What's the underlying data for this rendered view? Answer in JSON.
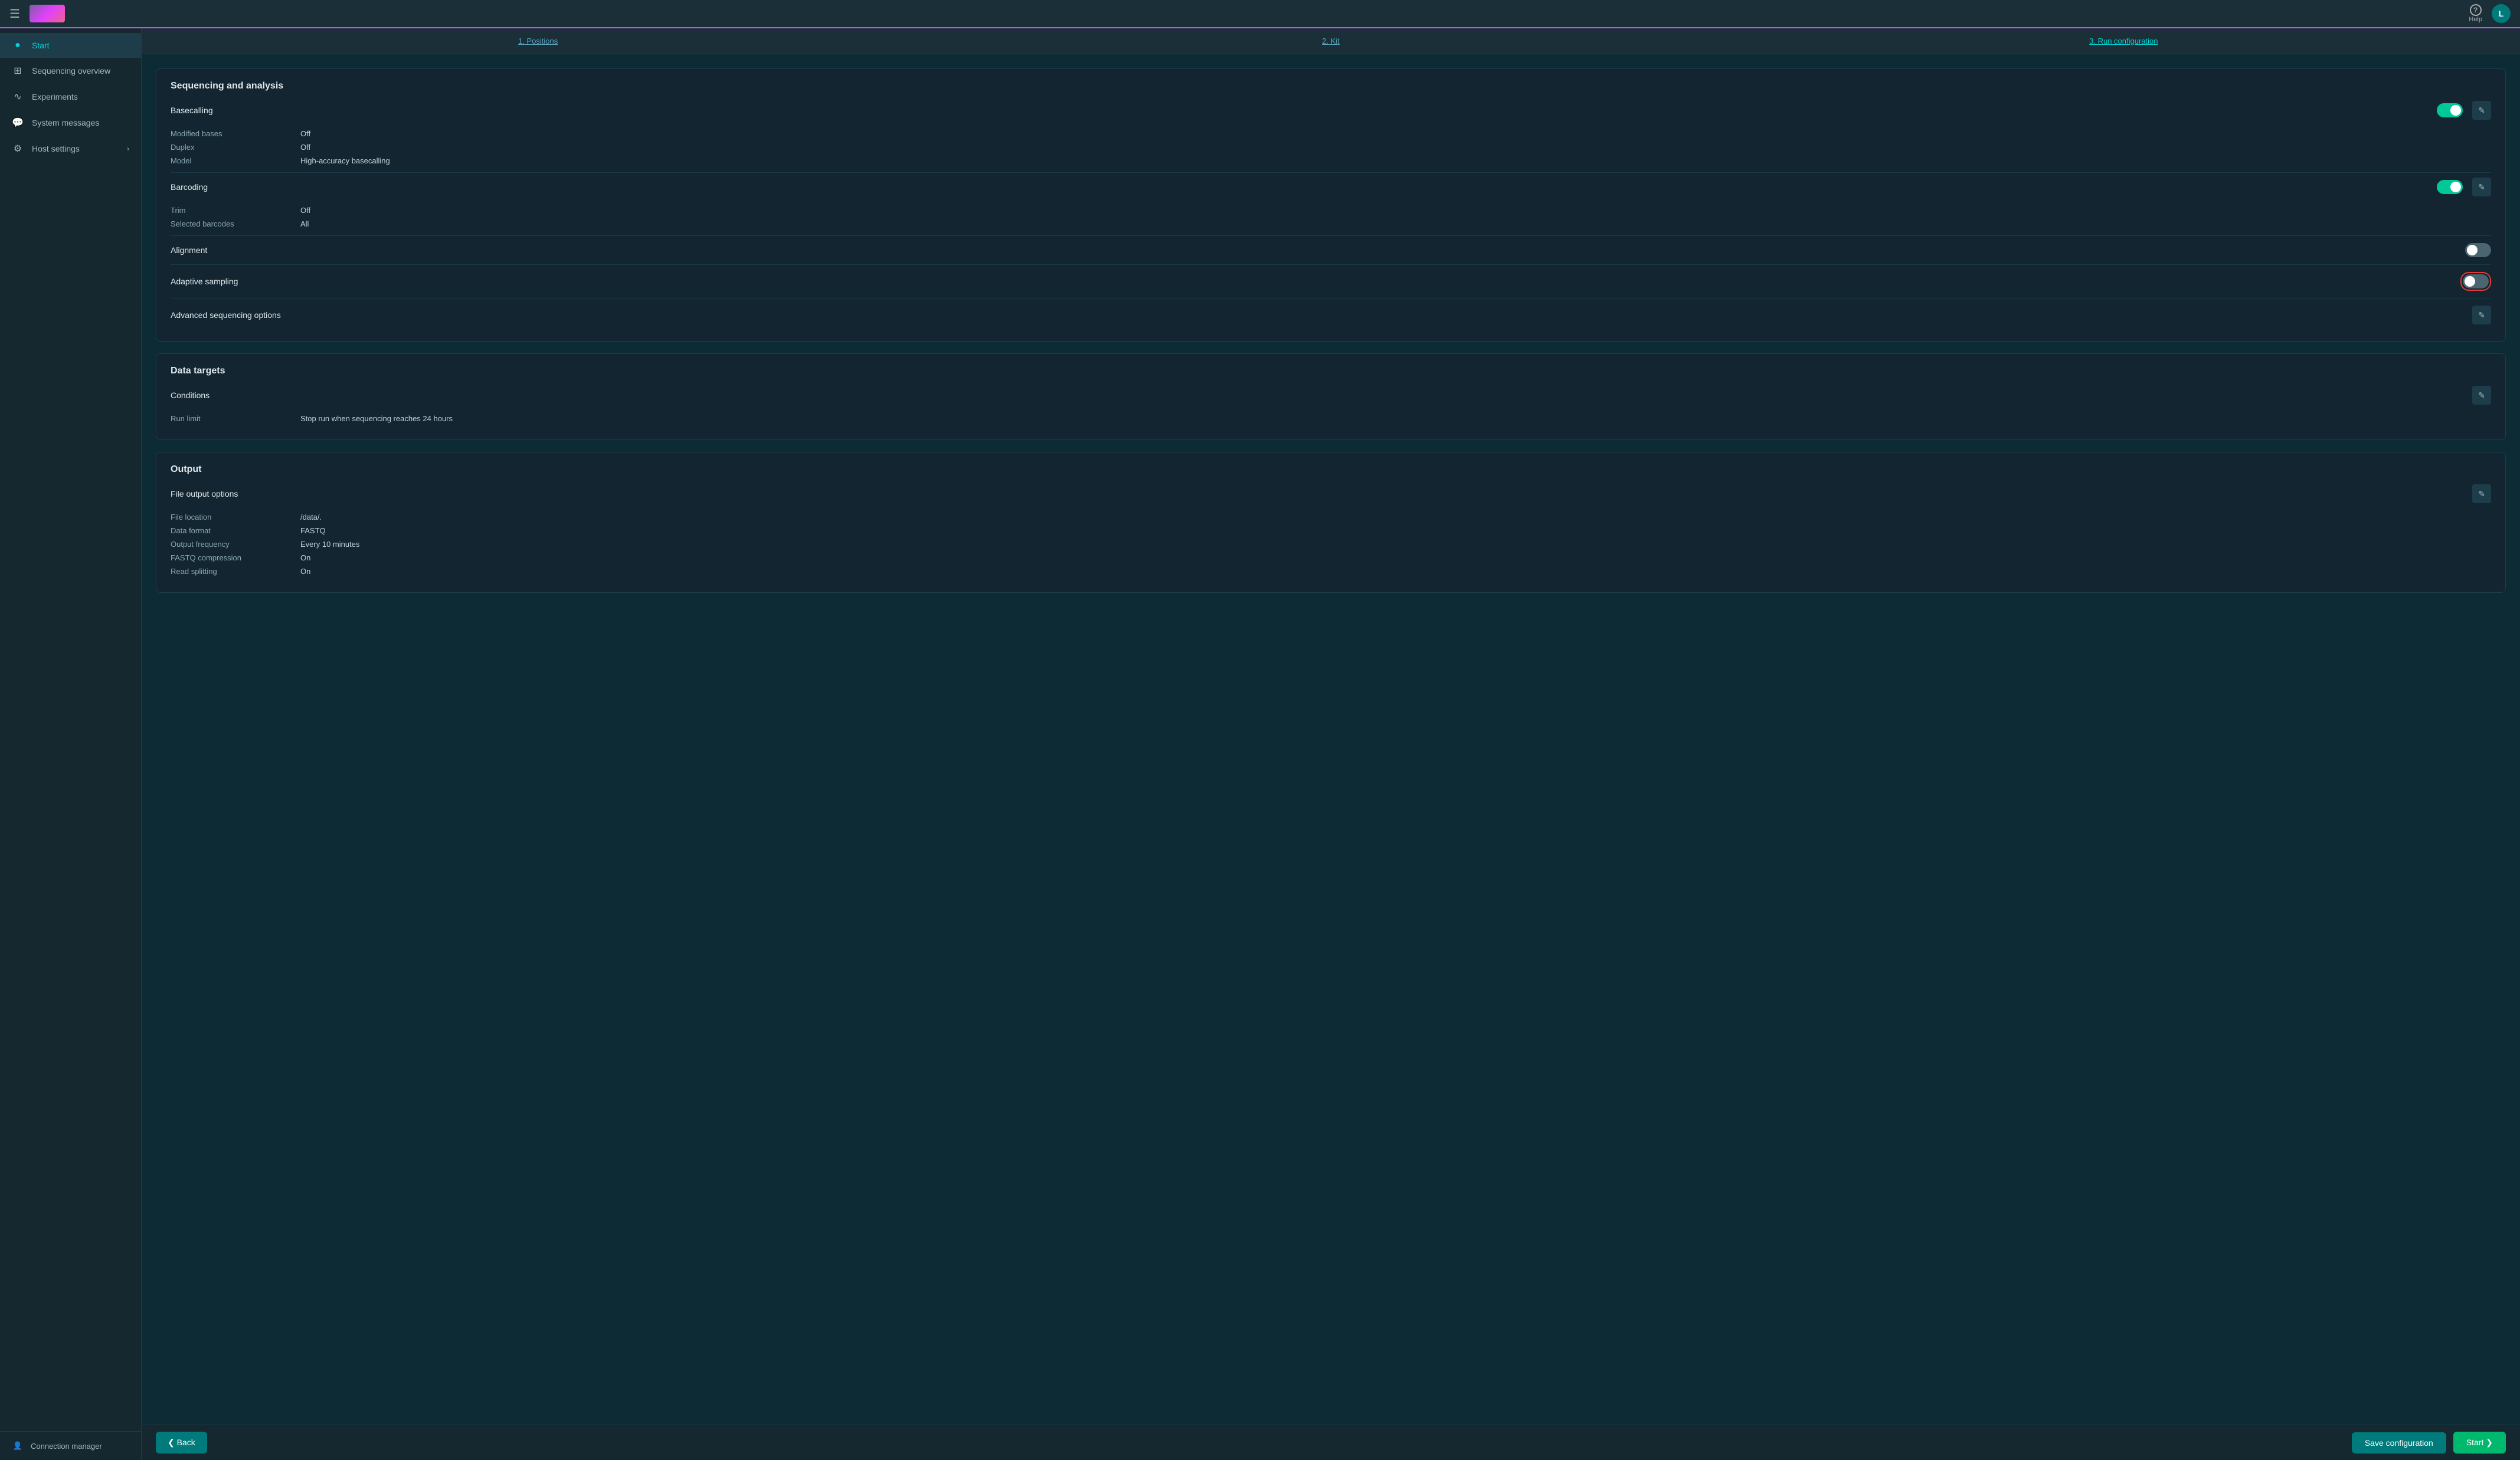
{
  "topbar": {
    "menu_label": "☰",
    "help_label": "Help",
    "avatar_label": "L"
  },
  "sidebar": {
    "items": [
      {
        "id": "start",
        "label": "Start",
        "icon": "●",
        "active": true
      },
      {
        "id": "sequencing-overview",
        "label": "Sequencing overview",
        "icon": "⊞"
      },
      {
        "id": "experiments",
        "label": "Experiments",
        "icon": "∿"
      },
      {
        "id": "system-messages",
        "label": "System messages",
        "icon": "💬"
      },
      {
        "id": "host-settings",
        "label": "Host settings",
        "icon": "⚙",
        "has_chevron": true
      }
    ],
    "bottom": {
      "icon": "👤",
      "label": "Connection manager"
    }
  },
  "step_nav": {
    "steps": [
      {
        "id": "positions",
        "label": "1. Positions"
      },
      {
        "id": "kit",
        "label": "2. Kit"
      },
      {
        "id": "run-configuration",
        "label": "3. Run configuration",
        "active": true
      }
    ]
  },
  "sequencing_analysis": {
    "section_title": "Sequencing and analysis",
    "basecalling": {
      "label": "Basecalling",
      "toggle_state": "on",
      "fields": [
        {
          "label": "Modified bases",
          "value": "Off"
        },
        {
          "label": "Duplex",
          "value": "Off"
        },
        {
          "label": "Model",
          "value": "High-accuracy basecalling"
        }
      ]
    },
    "barcoding": {
      "label": "Barcoding",
      "toggle_state": "on",
      "fields": [
        {
          "label": "Trim",
          "value": "Off"
        },
        {
          "label": "Selected barcodes",
          "value": "All"
        }
      ]
    },
    "alignment": {
      "label": "Alignment",
      "toggle_state": "off"
    },
    "adaptive_sampling": {
      "label": "Adaptive sampling",
      "toggle_state": "off",
      "highlighted": true
    },
    "advanced": {
      "label": "Advanced sequencing options"
    }
  },
  "data_targets": {
    "section_title": "Data targets",
    "conditions": {
      "label": "Conditions",
      "fields": [
        {
          "label": "Run limit",
          "value": "Stop run when sequencing reaches 24 hours"
        }
      ]
    }
  },
  "output": {
    "section_title": "Output",
    "file_output": {
      "label": "File output options",
      "fields": [
        {
          "label": "File location",
          "value": "/data/."
        },
        {
          "label": "Data format",
          "value": "FASTQ"
        },
        {
          "label": "Output frequency",
          "value": "Every 10 minutes"
        },
        {
          "label": "FASTQ compression",
          "value": "On"
        },
        {
          "label": "Read splitting",
          "value": "On"
        }
      ]
    }
  },
  "bottom_bar": {
    "back_label": "❮  Back",
    "save_label": "Save configuration",
    "start_label": "Start  ❯"
  },
  "icons": {
    "edit": "✎",
    "menu": "☰",
    "user_circle": "◎"
  }
}
